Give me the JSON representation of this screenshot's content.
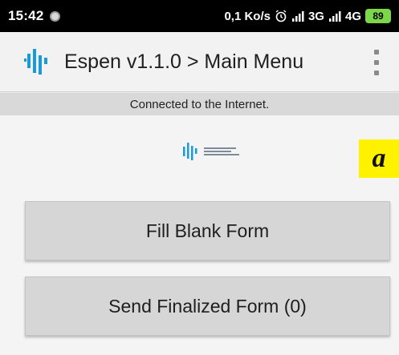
{
  "status_bar": {
    "time": "15:42",
    "speed": "0,1 Ko/s",
    "alarm_icon": "alarm-clock-icon",
    "network_3g": "3G",
    "network_4g": "4G",
    "battery": "89"
  },
  "toolbar": {
    "title": "Espen v1.1.0 > Main Menu",
    "logo_icon": "espen-logo-icon",
    "overflow_icon": "overflow-menu-icon"
  },
  "banner": {
    "text": "Connected to the Internet."
  },
  "main": {
    "badge": "a",
    "buttons": [
      {
        "label": "Fill Blank Form"
      },
      {
        "label": "Send Finalized Form (0)"
      }
    ]
  },
  "colors": {
    "logo_blue": "#1a9ad6",
    "badge_yellow": "#fff200",
    "battery_green": "#7bd64a"
  }
}
